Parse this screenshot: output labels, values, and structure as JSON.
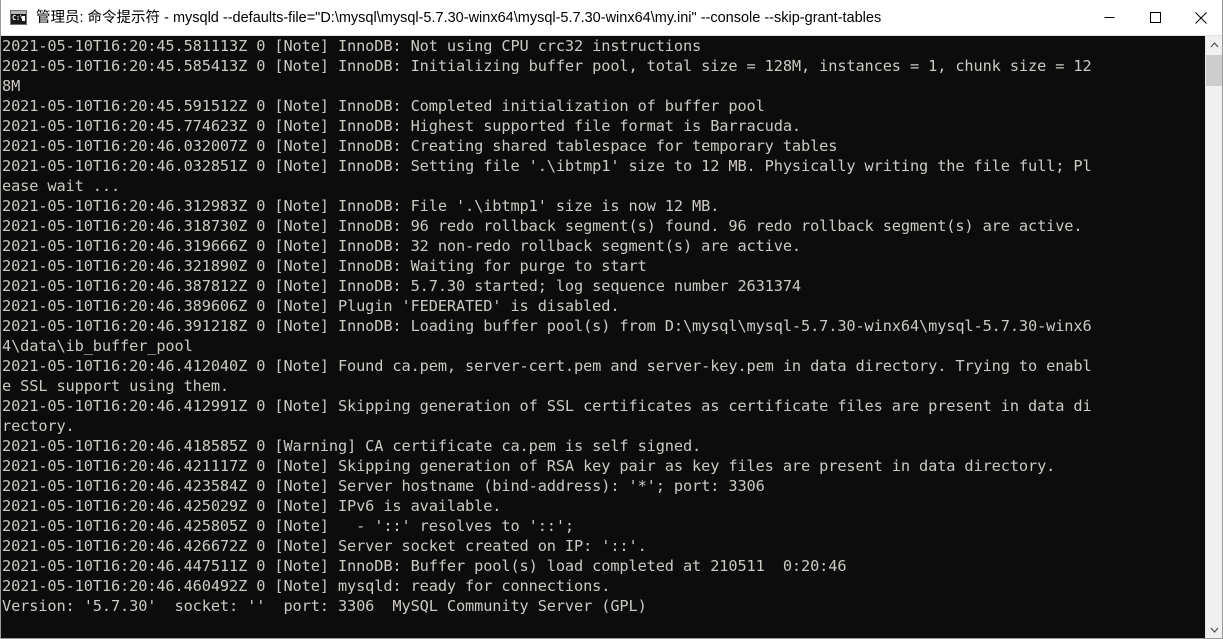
{
  "window": {
    "title": "管理员: 命令提示符 -  mysqld  --defaults-file=\"D:\\mysql\\mysql-5.7.30-winx64\\mysql-5.7.30-winx64\\my.ini\" --console --skip-grant-tables",
    "icon_name": "cmd-icon",
    "icon_text": "C:\\",
    "minimize_label": "—",
    "maximize_label": "□",
    "close_label": "✕",
    "background": "#0c0c0c",
    "foreground": "#ccc9c3"
  },
  "console": {
    "lines": [
      "2021-05-10T16:20:45.581113Z 0 [Note] InnoDB: Not using CPU crc32 instructions",
      "2021-05-10T16:20:45.585413Z 0 [Note] InnoDB: Initializing buffer pool, total size = 128M, instances = 1, chunk size = 12",
      "8M",
      "2021-05-10T16:20:45.591512Z 0 [Note] InnoDB: Completed initialization of buffer pool",
      "2021-05-10T16:20:45.774623Z 0 [Note] InnoDB: Highest supported file format is Barracuda.",
      "2021-05-10T16:20:46.032007Z 0 [Note] InnoDB: Creating shared tablespace for temporary tables",
      "2021-05-10T16:20:46.032851Z 0 [Note] InnoDB: Setting file '.\\ibtmp1' size to 12 MB. Physically writing the file full; Pl",
      "ease wait ...",
      "2021-05-10T16:20:46.312983Z 0 [Note] InnoDB: File '.\\ibtmp1' size is now 12 MB.",
      "2021-05-10T16:20:46.318730Z 0 [Note] InnoDB: 96 redo rollback segment(s) found. 96 redo rollback segment(s) are active.",
      "2021-05-10T16:20:46.319666Z 0 [Note] InnoDB: 32 non-redo rollback segment(s) are active.",
      "2021-05-10T16:20:46.321890Z 0 [Note] InnoDB: Waiting for purge to start",
      "2021-05-10T16:20:46.387812Z 0 [Note] InnoDB: 5.7.30 started; log sequence number 2631374",
      "2021-05-10T16:20:46.389606Z 0 [Note] Plugin 'FEDERATED' is disabled.",
      "2021-05-10T16:20:46.391218Z 0 [Note] InnoDB: Loading buffer pool(s) from D:\\mysql\\mysql-5.7.30-winx64\\mysql-5.7.30-winx6",
      "4\\data\\ib_buffer_pool",
      "2021-05-10T16:20:46.412040Z 0 [Note] Found ca.pem, server-cert.pem and server-key.pem in data directory. Trying to enabl",
      "e SSL support using them.",
      "2021-05-10T16:20:46.412991Z 0 [Note] Skipping generation of SSL certificates as certificate files are present in data di",
      "rectory.",
      "2021-05-10T16:20:46.418585Z 0 [Warning] CA certificate ca.pem is self signed.",
      "2021-05-10T16:20:46.421117Z 0 [Note] Skipping generation of RSA key pair as key files are present in data directory.",
      "2021-05-10T16:20:46.423584Z 0 [Note] Server hostname (bind-address): '*'; port: 3306",
      "2021-05-10T16:20:46.425029Z 0 [Note] IPv6 is available.",
      "2021-05-10T16:20:46.425805Z 0 [Note]   - '::' resolves to '::';",
      "2021-05-10T16:20:46.426672Z 0 [Note] Server socket created on IP: '::'.",
      "2021-05-10T16:20:46.447511Z 0 [Note] InnoDB: Buffer pool(s) load completed at 210511  0:20:46",
      "2021-05-10T16:20:46.460492Z 0 [Note] mysqld: ready for connections.",
      "Version: '5.7.30'  socket: ''  port: 3306  MySQL Community Server (GPL)"
    ]
  },
  "scrollbar": {
    "up_arrow": "˄",
    "down_arrow": "˅"
  }
}
